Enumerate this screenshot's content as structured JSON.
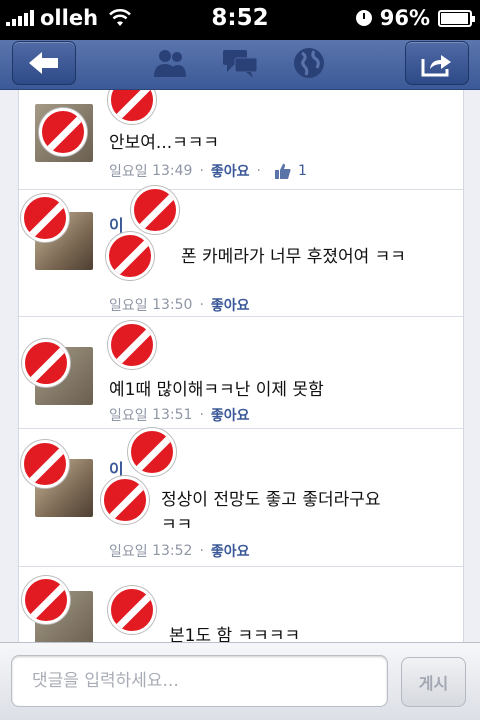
{
  "status": {
    "carrier": "olleh",
    "time": "8:52",
    "battery": "96%",
    "battery_level": 0.96
  },
  "navbar": {
    "icons": [
      "back-arrow-icon",
      "friends-icon",
      "messages-icon",
      "globe-icon",
      "share-icon"
    ]
  },
  "comments": [
    {
      "text": "안보여...ㅋㅋㅋ",
      "day": "일요일",
      "time": "13:49",
      "like_label": "좋아요",
      "like_count": "1"
    },
    {
      "name": "이",
      "text": "폰 카메라가 너무 후졌어여 ㅋㅋ",
      "day": "일요일",
      "time": "13:50",
      "like_label": "좋아요"
    },
    {
      "text": "예1때 많이해ㅋㅋ난 이제 못함",
      "day": "일요일",
      "time": "13:51",
      "like_label": "좋아요"
    },
    {
      "name": "이",
      "text": "정상이 전망도 좋고 좋더라구요",
      "text2": "ㅋㅋ",
      "day": "일요일",
      "time": "13:52",
      "like_label": "좋아요"
    },
    {
      "text": "본1도 함 ㅋㅋㅋㅋ"
    }
  ],
  "composer": {
    "placeholder": "댓글을 입력하세요...",
    "post_label": "게시"
  },
  "colors": {
    "brand": "#3b5998",
    "badge": "#e21b23"
  }
}
